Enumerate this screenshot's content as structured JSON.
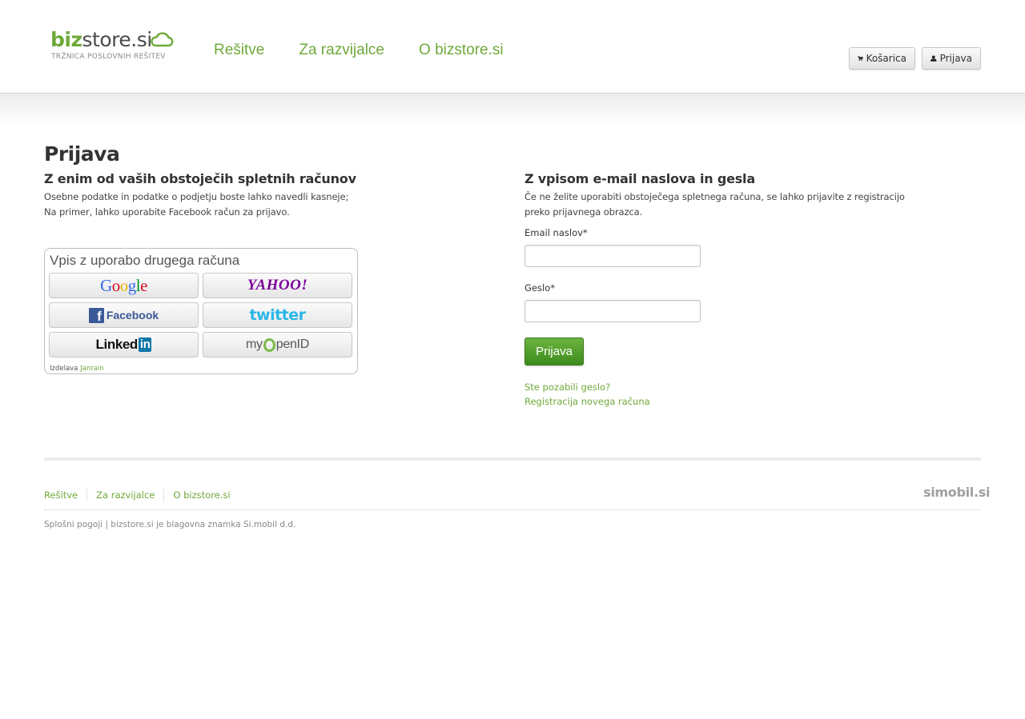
{
  "header": {
    "logo": {
      "brand_biz": "biz",
      "brand_rest": "store.si",
      "tagline": "TRŽNICA POSLOVNIH REŠITEV"
    },
    "nav": [
      "Rešitve",
      "Za razvijalce",
      "O bizstore.si"
    ],
    "cart_label": "Košarica",
    "login_label": "Prijava"
  },
  "page": {
    "title": "Prijava",
    "left": {
      "heading": "Z enim od vaših obstoječih spletnih računov",
      "text_line1": "Osebne podatke in podatke o podjetju boste lahko navedli kasneje;",
      "text_line2": "Na primer, lahko uporabite Facebook račun za prijavo.",
      "widget": {
        "title": "Vpis z uporabo drugega računa",
        "providers": [
          "Google",
          "YAHOO!",
          "Facebook",
          "twitter",
          "Linked",
          "in",
          "my",
          "penID"
        ],
        "powered_prefix": "Izdelava",
        "powered_link": "Janrain"
      }
    },
    "right": {
      "heading": "Z vpisom e-mail naslova in gesla",
      "text_line1": "Če ne želite uporabiti obstoječega spletnega računa, se lahko prijavite z registracijo",
      "text_line2": "preko prijavnega obrazca.",
      "email_label": "Email naslov*",
      "email_value": "",
      "password_label": "Geslo*",
      "password_value": "",
      "submit_label": "Prijava",
      "forgot_link": "Ste pozabili geslo?",
      "register_link": "Registracija novega računa"
    }
  },
  "footer": {
    "nav": [
      "Rešitve",
      "Za razvijalce",
      "O bizstore.si"
    ],
    "partner": "simobil.si",
    "legal": "Splošni pogoji | bizstore.si je blagovna znamka Si.mobil d.d."
  },
  "colors": {
    "accent_green": "#6fa93a",
    "button_green": "#4a9a26",
    "text_dark": "#333333",
    "google_blue": "#3369e8",
    "google_red": "#d50f25",
    "google_yellow": "#eeb211",
    "google_green": "#009925"
  },
  "icons": [
    "cloud-icon",
    "cart-icon",
    "user-icon"
  ]
}
